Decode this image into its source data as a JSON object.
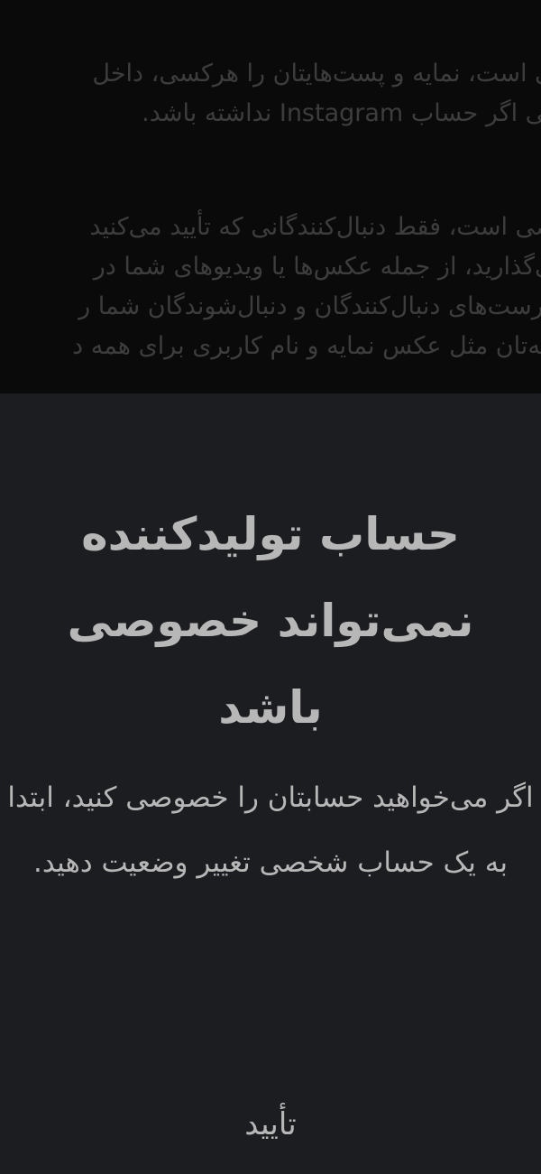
{
  "background_text": {
    "public_paragraph": [
      "می است، نمایه و پست‌هایتان را هرکسی، داخل",
      "حتی اگر حساب Instagram نداشته باشد."
    ],
    "private_paragraph": [
      "وصی است، فقط دنبال‌کنندگانی که تأیید می‌کنید",
      "می‌گذارید، از جمله عکس‌ها یا ویدیوهای شما در",
      "فهرست‌های دنبال‌کنندگان و دنبال‌شوندگان شما ر",
      "مایه‌تان مثل عکس نمایه و نام کاربری برای همه د"
    ]
  },
  "dialog": {
    "title": "حساب تولیدکننده نمی‌تواند خصوصی باشد",
    "message": "اگر می‌خواهید حسابتان را خصوصی کنید، ابتدا به یک حساب شخصی تغییر وضعیت دهید.",
    "confirm_label": "تأیید"
  },
  "colors": {
    "screen_background": "#0a0a0a",
    "sheet_background": "#1c1d20",
    "text_primary": "#b7b7b7",
    "text_dimmed": "#3d3d3d"
  }
}
